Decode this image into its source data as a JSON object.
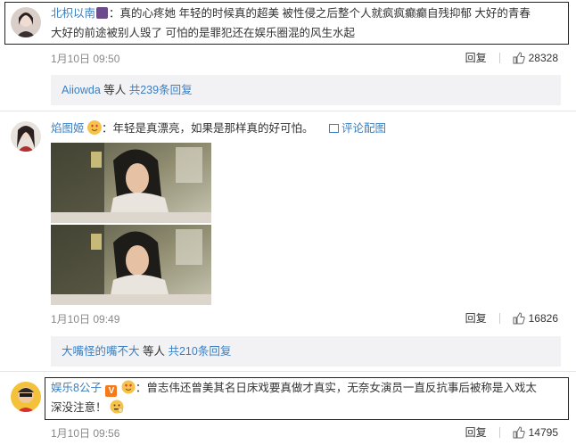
{
  "comments": [
    {
      "username": "北枳以南",
      "text_line1": "：真的心疼她 年轻的时候真的超美 被性侵之后整个人就疯疯癫癫自残抑郁 大好的青春",
      "text_line2": "大好的前途被别人毁了 可怕的是罪犯还在娱乐圈混的风生水起",
      "time": "1月10日 09:50",
      "reply_label": "回复",
      "likes": "28328",
      "replies": {
        "name": "Aiiowda",
        "middle": " 等人 ",
        "link": "共239条回复"
      }
    },
    {
      "username": "焰图姬",
      "text": "：年轻是真漂亮，如果是那样真的好可怕。",
      "image_link": "评论配图",
      "time": "1月10日 09:49",
      "reply_label": "回复",
      "likes": "16826",
      "replies": {
        "name": "大嘴怪的嘴不大",
        "middle": " 等人 ",
        "link": "共210条回复"
      }
    },
    {
      "username": "娱乐8公子",
      "text_line1": "：曾志伟还曾美其名日床戏要真做才真实，无奈女演员一直反抗事后被称是入戏太",
      "text_line2": "深没注意！",
      "time": "1月10日 09:56",
      "reply_label": "回复",
      "likes": "14795"
    }
  ]
}
